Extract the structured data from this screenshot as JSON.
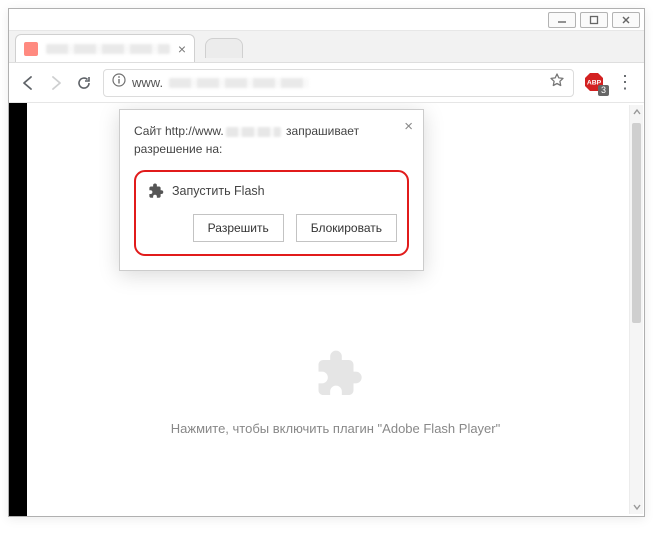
{
  "window": {
    "controls": {
      "min": "–",
      "max": "☐",
      "close": "✕"
    }
  },
  "tab": {
    "close_glyph": "×"
  },
  "nav": {
    "url_prefix": "www.",
    "back_title": "Назад",
    "fwd_title": "Вперёд",
    "reload_title": "Обновить",
    "star_title": "Добавить в закладки",
    "menu_title": "Меню"
  },
  "abp": {
    "label": "ABP",
    "count": "3"
  },
  "perm": {
    "line1_a": "Сайт http://www.",
    "line1_b": " запрашивает",
    "line2": "разрешение на:",
    "run_label": "Запустить Flash",
    "allow": "Разрешить",
    "block": "Блокировать",
    "close_glyph": "×"
  },
  "plugin": {
    "message": "Нажмите, чтобы включить плагин \"Adobe Flash Player\""
  }
}
